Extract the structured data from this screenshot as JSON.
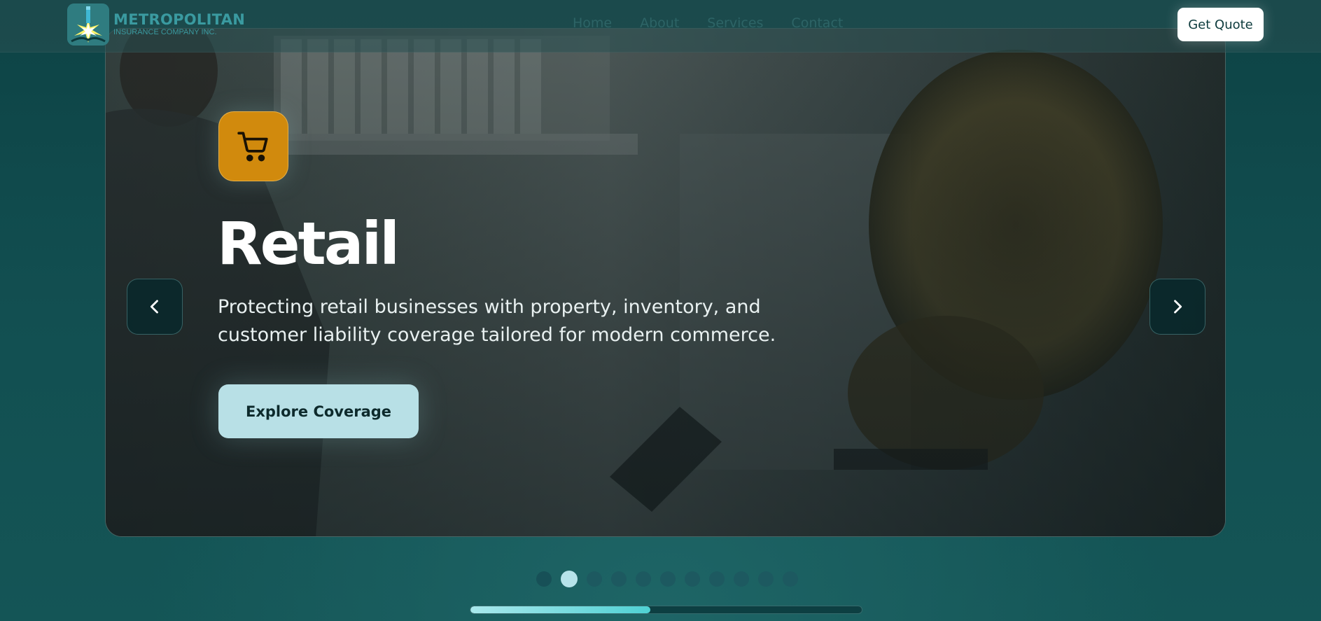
{
  "header": {
    "logo": {
      "name": "METROPOLITAN",
      "subtitle": "INSURANCE COMPANY INC.",
      "icon": "starburst-pen-logo-icon"
    },
    "nav": [
      {
        "label": "Home"
      },
      {
        "label": "About"
      },
      {
        "label": "Services"
      },
      {
        "label": "Contact"
      }
    ],
    "cta_label": "Get Quote"
  },
  "slide": {
    "category_icon": "shopping-cart-icon",
    "title": "Retail",
    "description": "Protecting retail businesses with property, inventory, and customer liability coverage tailored for modern commerce.",
    "button_label": "Explore Coverage",
    "prev_icon": "chevron-left-icon",
    "next_icon": "chevron-right-icon"
  },
  "carousel": {
    "total_slides": 11,
    "active_index": 1,
    "progress": 0.46
  },
  "colors": {
    "background": "#0f4a4c",
    "accent_icon": "#d18a0d",
    "button_bg": "#b8e0e6",
    "progress_fill": "#4fd1d4"
  }
}
